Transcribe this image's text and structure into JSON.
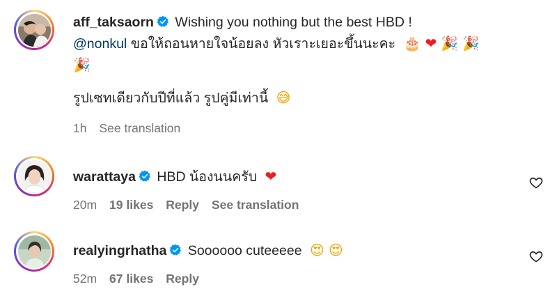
{
  "comments": [
    {
      "username": "aff_taksaorn",
      "verified": true,
      "text_line1": "Wishing you nothing but the best HBD !",
      "mention": "@nonkul",
      "text_line2": "ขอให้ถอนหายใจน้อยลง หัวเราะเยอะขึ้นนะคะ",
      "emojis_line2": [
        "🎂",
        "❤",
        "🎉",
        "🎉"
      ],
      "emoji_line3": "🎉",
      "text_line4": "รูปเซทเดียวกับปีที่แล้ว รูปคู่มีเท่านี้",
      "emoji_line4": "😅",
      "time": "1h",
      "see_translation": "See translation"
    },
    {
      "username": "warattaya",
      "verified": true,
      "text": "HBD น้องนนครับ",
      "emoji": "❤",
      "time": "20m",
      "likes": "19 likes",
      "reply": "Reply",
      "see_translation": "See translation"
    },
    {
      "username": "realyingrhatha",
      "verified": true,
      "text": "Soooooo cuteeeee",
      "emojis": [
        "😍",
        "😍"
      ],
      "time": "52m",
      "likes": "67 likes",
      "reply": "Reply"
    }
  ],
  "icons": {
    "verified": "verified-badge-icon",
    "like": "heart-outline-icon"
  },
  "colors": {
    "verified": "#0095f6",
    "mention": "#00376b",
    "meta": "#737373",
    "heart": "#ed1c24"
  }
}
